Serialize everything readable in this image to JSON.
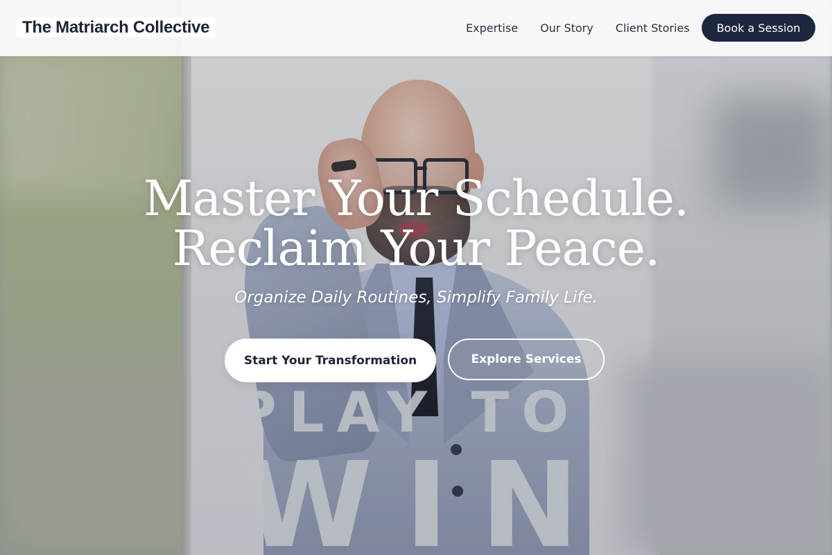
{
  "header": {
    "brand": "The Matriarch Collective",
    "nav": [
      {
        "label": "Expertise"
      },
      {
        "label": "Our Story"
      },
      {
        "label": "Client Stories"
      }
    ],
    "cta_label": "Book a Session"
  },
  "hero": {
    "title_line1": "Master Your Schedule.",
    "title_line2": "Reclaim Your Peace.",
    "subtitle": "Organize Daily Routines, Simplify Family Life.",
    "primary_cta": "Start Your Transformation",
    "secondary_cta": "Explore Services"
  },
  "background_image": {
    "book_cover_text_line1": "PLAY TO",
    "book_cover_text_line2": "WIN"
  },
  "colors": {
    "header_bg": "#fafafa",
    "brand_text": "#1e2433",
    "accent_dark": "#1e2740",
    "hero_text": "#ffffff"
  }
}
